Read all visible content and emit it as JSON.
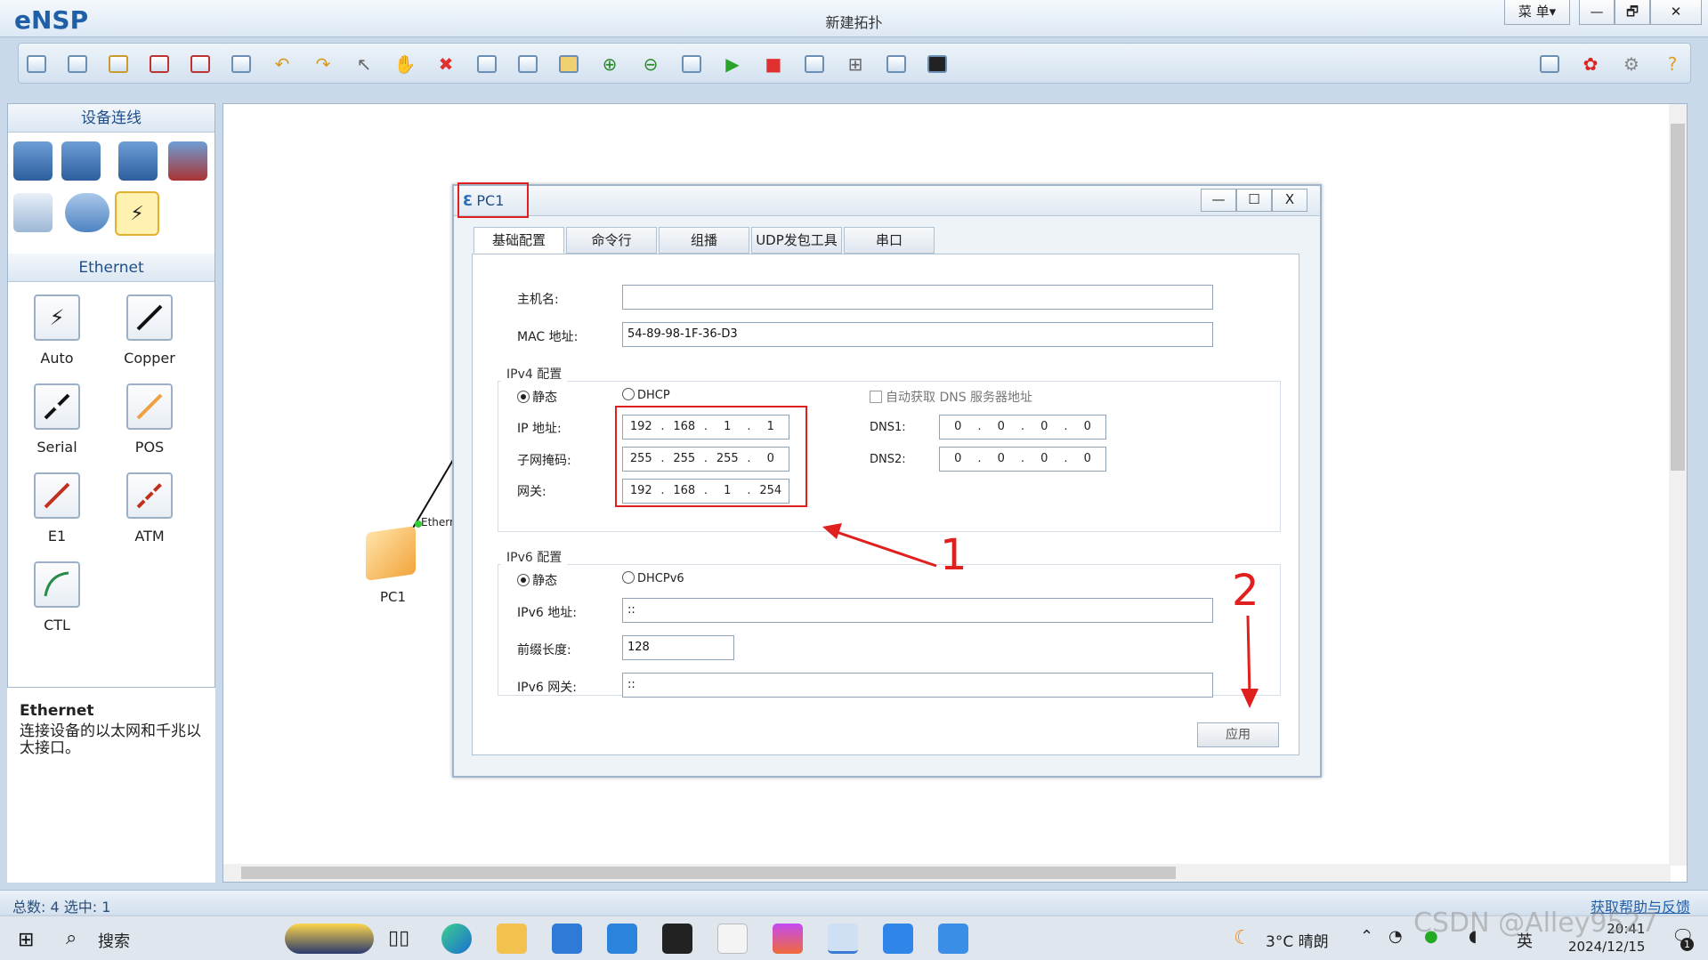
{
  "app": {
    "logo": "eNSP",
    "title": "新建拓扑",
    "menu_label": "菜 单▾",
    "minimize": "—",
    "restore": "🗗",
    "close": "✕"
  },
  "left_panel": {
    "section1_title": "设备连线",
    "section2_title": "Ethernet",
    "links": [
      {
        "label": "Auto"
      },
      {
        "label": "Copper"
      },
      {
        "label": "Serial"
      },
      {
        "label": "POS"
      },
      {
        "label": "E1"
      },
      {
        "label": "ATM"
      },
      {
        "label": "CTL"
      }
    ],
    "desc_title": "Ethernet",
    "desc_body": "连接设备的以太网和千兆以太接口。"
  },
  "canvas": {
    "device_label": "PC1",
    "port_label": "Ethern"
  },
  "dialog": {
    "title": "PC1",
    "min": "—",
    "max": "☐",
    "close": "X",
    "tabs": [
      "基础配置",
      "命令行",
      "组播",
      "UDP发包工具",
      "串口"
    ],
    "hostname_label": "主机名:",
    "hostname_value": "",
    "mac_label": "MAC 地址:",
    "mac_value": "54-89-98-1F-36-D3",
    "ipv4_group": "IPv4 配置",
    "static_label": "静态",
    "dhcp_label": "DHCP",
    "auto_dns_label": "自动获取 DNS 服务器地址",
    "ip_label": "IP 地址:",
    "ip_value": [
      "192",
      "168",
      "1",
      "1"
    ],
    "mask_label": "子网掩码:",
    "mask_value": [
      "255",
      "255",
      "255",
      "0"
    ],
    "gateway_label": "网关:",
    "gateway_value": [
      "192",
      "168",
      "1",
      "254"
    ],
    "dns1_label": "DNS1:",
    "dns1_value": [
      "0",
      "0",
      "0",
      "0"
    ],
    "dns2_label": "DNS2:",
    "dns2_value": [
      "0",
      "0",
      "0",
      "0"
    ],
    "ipv6_group": "IPv6 配置",
    "static6_label": "静态",
    "dhcpv6_label": "DHCPv6",
    "ipv6_label": "IPv6 地址:",
    "ipv6_value": "::",
    "prefix_label": "前缀长度:",
    "prefix_value": "128",
    "gw6_label": "IPv6 网关:",
    "gw6_value": "::",
    "apply_label": "应用"
  },
  "annotations": {
    "n1": "1",
    "n2": "2",
    "color": "#e0201f"
  },
  "status": {
    "left": "总数: 4 选中: 1",
    "right": "获取帮助与反馈"
  },
  "taskbar": {
    "search": "搜索",
    "temp": "3°C 晴朗",
    "lang": "英",
    "time": "20:41",
    "date": "2024/12/15",
    "notif": "1",
    "watermark": "CSDN @Alley9527"
  }
}
